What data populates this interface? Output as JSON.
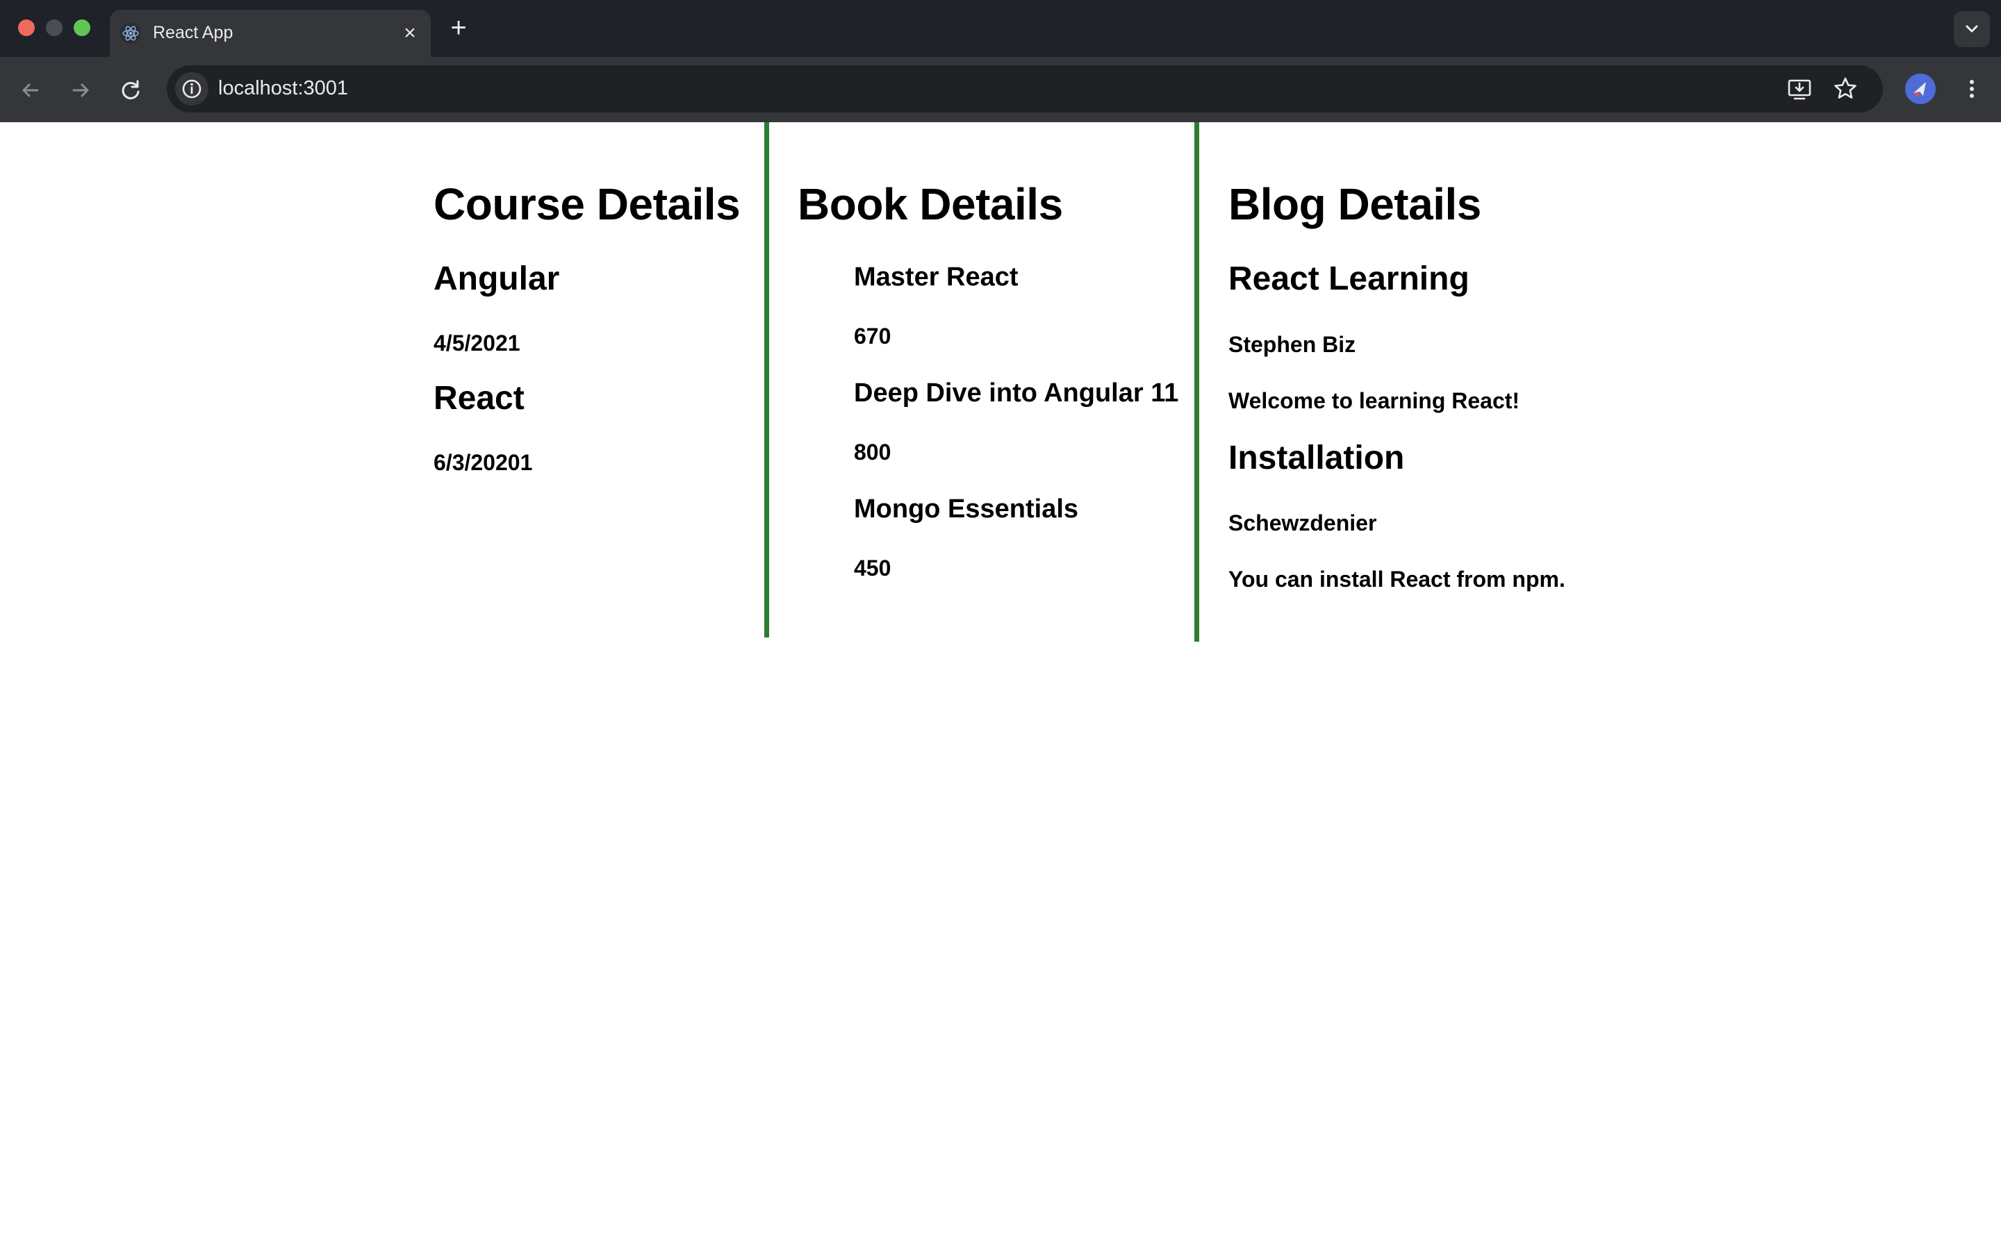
{
  "browser": {
    "tab_title": "React App",
    "url": "localhost:3001"
  },
  "courses": {
    "heading": "Course Details",
    "items": [
      {
        "name": "Angular",
        "date": "4/5/2021"
      },
      {
        "name": "React",
        "date": "6/3/20201"
      }
    ]
  },
  "books": {
    "heading": "Book Details",
    "items": [
      {
        "name": "Master React",
        "price": "670"
      },
      {
        "name": "Deep Dive into Angular 11",
        "price": "800"
      },
      {
        "name": "Mongo Essentials",
        "price": "450"
      }
    ]
  },
  "blogs": {
    "heading": "Blog Details",
    "items": [
      {
        "title": "React Learning",
        "author": "Stephen Biz",
        "content": "Welcome to learning React!"
      },
      {
        "title": "Installation",
        "author": "Schewzdenier",
        "content": "You can install React from npm."
      }
    ]
  },
  "colors": {
    "divider": "#2f7d32",
    "tabstrip": "#1f2228",
    "toolbar": "#35363a"
  },
  "icons": {
    "back": "arrow-left-icon",
    "forward": "arrow-right-icon",
    "reload": "reload-icon",
    "site_info": "info-icon",
    "install": "install-app-icon",
    "bookmark": "star-icon",
    "menu": "more-vertical-icon"
  }
}
